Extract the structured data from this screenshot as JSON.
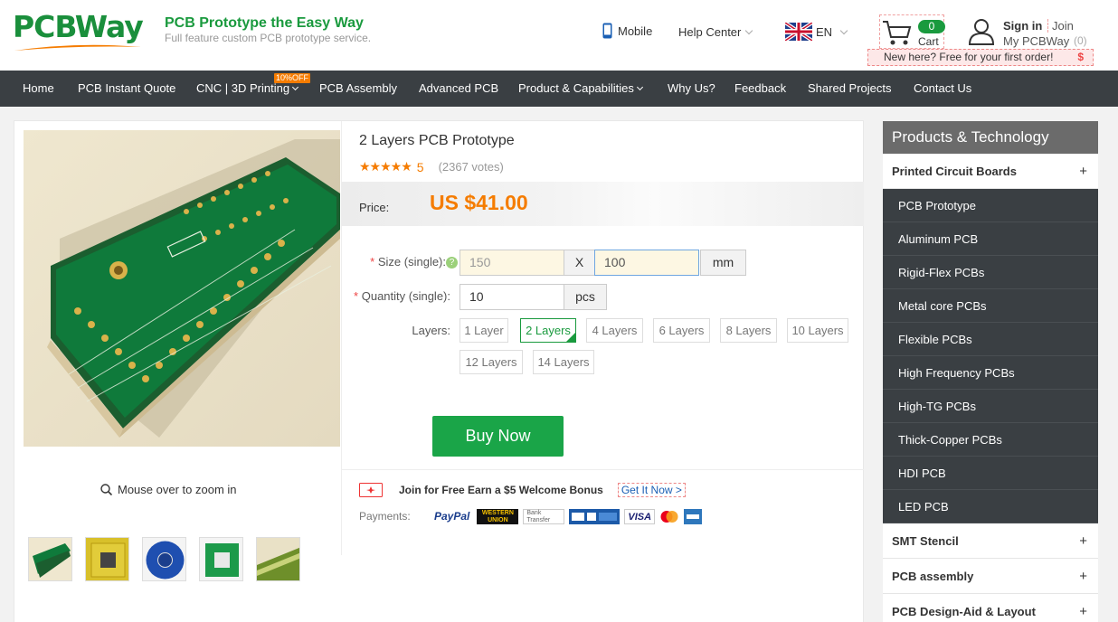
{
  "brand": {
    "logo_text_pcb": "PCB",
    "logo_text_way": "Way",
    "tagline_title": "PCB Prototype the Easy Way",
    "tagline_sub": "Full feature custom PCB prototype service."
  },
  "header": {
    "mobile": "Mobile",
    "help_center": "Help Center",
    "language": "EN",
    "cart_count": "0",
    "cart_label": "Cart",
    "sign_in": "Sign in",
    "join": "Join",
    "my_pcbway": "My PCBWay",
    "my_count": "(0)",
    "new_here": "New here? Free for your first order!",
    "new_here_icon": "$"
  },
  "nav": {
    "items": [
      {
        "label": "Home"
      },
      {
        "label": "PCB Instant Quote"
      },
      {
        "label": "CNC | 3D Printing",
        "badge": "10%OFF"
      },
      {
        "label": "PCB Assembly"
      },
      {
        "label": "Advanced PCB"
      },
      {
        "label": "Product & Capabilities"
      },
      {
        "label": "Why Us?"
      },
      {
        "label": "Feedback"
      },
      {
        "label": "Shared Projects"
      },
      {
        "label": "Contact Us"
      }
    ]
  },
  "product": {
    "title": "2 Layers PCB Prototype",
    "stars": "★★★★★",
    "rating": "5",
    "votes": "(2367 votes)",
    "price_label": "Price:",
    "price": "US $41.00",
    "zoom_hint": "Mouse over to zoom in"
  },
  "form": {
    "size_label": "Size (single):",
    "size_required": "*",
    "size_help": "?",
    "size_w": "150",
    "size_x": "X",
    "size_h": "100",
    "size_unit": "mm",
    "qty_label": "Quantity (single):",
    "qty_required": "*",
    "qty_value": "10",
    "qty_unit": "pcs",
    "layers_label": "Layers:",
    "layers": [
      "1 Layer",
      "2 Layers",
      "4 Layers",
      "6 Layers",
      "8 Layers",
      "10 Layers",
      "12 Layers",
      "14 Layers"
    ],
    "selected_layer": "2 Layers",
    "buy_now": "Buy Now"
  },
  "promo": {
    "text": "Join for Free Earn a $5 Welcome Bonus",
    "link": "Get It Now >",
    "payments_label": "Payments:",
    "payment_logos": [
      "PayPal",
      "WESTERN UNION",
      "Bank Transfer",
      "VISA",
      "Mastercard",
      "American Express"
    ]
  },
  "sidebar": {
    "title": "Products & Technology",
    "categories": [
      {
        "label": "Printed Circuit Boards",
        "toggle": "+"
      },
      {
        "label": "SMT Stencil",
        "toggle": "+"
      },
      {
        "label": "PCB assembly",
        "toggle": "+"
      },
      {
        "label": "PCB Design-Aid & Layout",
        "toggle": "+"
      }
    ],
    "pcb_items": [
      "PCB Prototype",
      "Aluminum PCB",
      "Rigid-Flex PCBs",
      "Metal core PCBs",
      "Flexible PCBs",
      "High Frequency PCBs",
      "High-TG PCBs",
      "Thick-Copper PCBs",
      "HDI PCB",
      "LED PCB"
    ]
  },
  "colors": {
    "brand_green": "#1a9a3e",
    "price_orange": "#f57c00",
    "nav_dark": "#3a3f43",
    "buy_green": "#1aa548"
  }
}
